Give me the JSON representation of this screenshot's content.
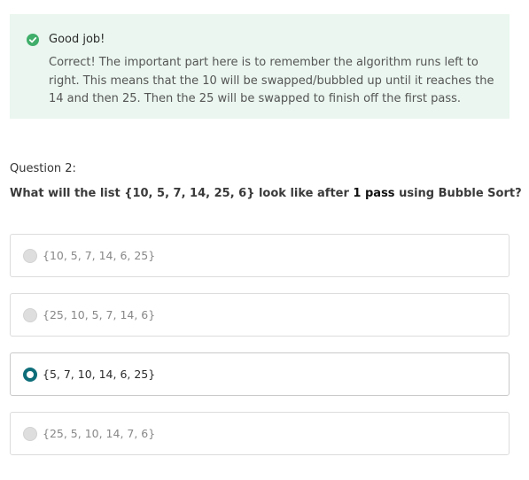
{
  "feedback": {
    "icon": "check-circle-icon",
    "title": "Good job!",
    "body": "Correct! The important part here is to remember the algorithm runs left to right. This means that the 10 will be swapped/bubbled up until it reaches the 14 and then 25. Then the 25 will be swapped to finish off the first pass.",
    "colors": {
      "background": "#eaf6ef",
      "icon": "#3fae6a"
    }
  },
  "question": {
    "number_label": "Question 2:",
    "prompt_before": "What will the list {10, 5, 7, 14, 25, 6} look like after ",
    "prompt_emphasis": "1 pass",
    "prompt_after": " using Bubble Sort?"
  },
  "options": [
    {
      "label": "{10, 5, 7, 14, 6, 25}",
      "selected": false
    },
    {
      "label": "{25, 10, 5, 7, 14, 6}",
      "selected": false
    },
    {
      "label": "{5, 7, 10, 14, 6, 25}",
      "selected": true
    },
    {
      "label": "{25, 5, 10, 14, 7, 6}",
      "selected": false
    }
  ],
  "colors": {
    "selected_radio": "#0e6e7a",
    "unselected_radio": "#dedede"
  }
}
